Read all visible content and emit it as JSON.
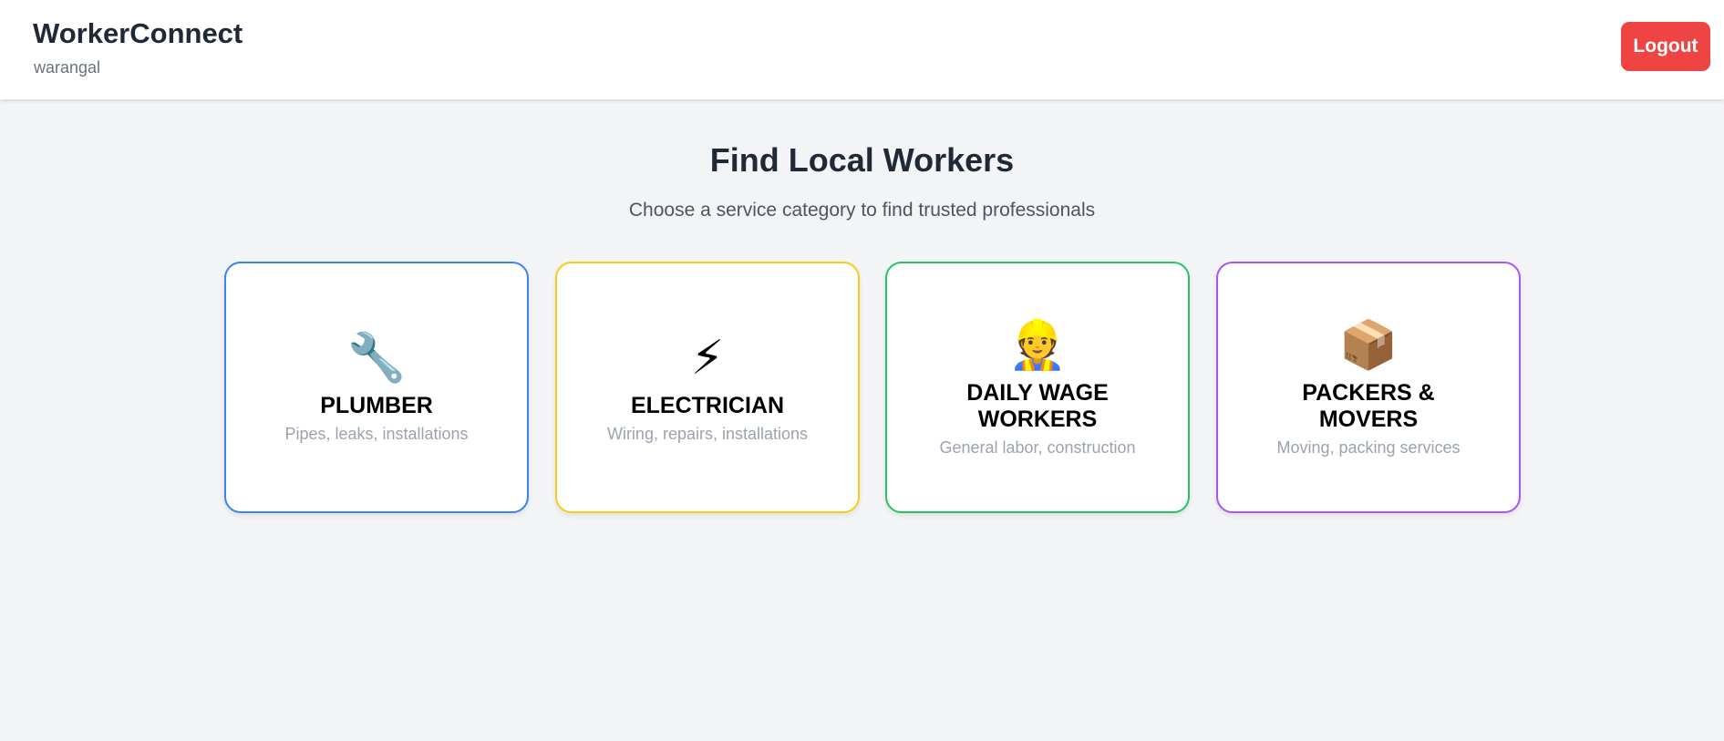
{
  "header": {
    "brand": "WorkerConnect",
    "city": "warangal",
    "logout_label": "Logout"
  },
  "main": {
    "title": "Find Local Workers",
    "subtitle": "Choose a service category to find trusted professionals"
  },
  "categories": [
    {
      "icon": "🔧",
      "icon_name": "wrench-icon",
      "name": "PLUMBER",
      "description": "Pipes, leaks, installations",
      "border_color": "#3b82f6"
    },
    {
      "icon": "⚡",
      "icon_name": "lightning-icon",
      "name": "ELECTRICIAN",
      "description": "Wiring, repairs, installations",
      "border_color": "#facc15"
    },
    {
      "icon": "👷",
      "icon_name": "construction-worker-icon",
      "name": "DAILY WAGE WORKERS",
      "description": "General labor, construction",
      "border_color": "#22c55e"
    },
    {
      "icon": "📦",
      "icon_name": "package-icon",
      "name": "PACKERS & MOVERS",
      "description": "Moving, packing services",
      "border_color": "#a855f7"
    }
  ],
  "colors": {
    "logout": "#ef4444",
    "background": "#f3f4f6"
  }
}
